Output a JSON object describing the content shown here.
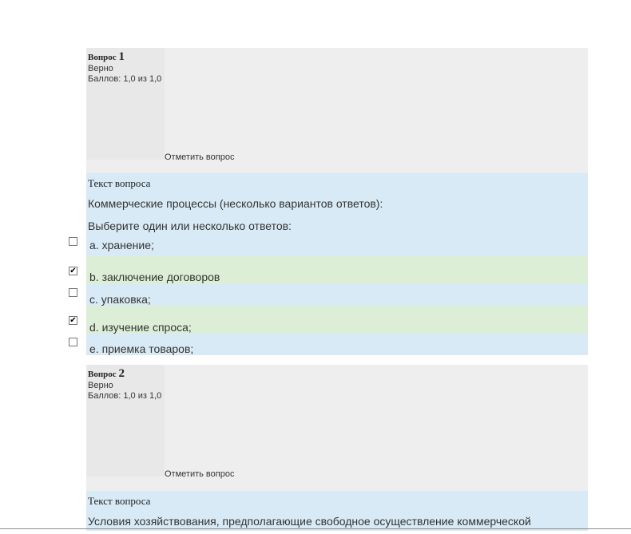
{
  "questions": [
    {
      "label": "Вопрос",
      "number": "1",
      "state": "Верно",
      "grade": "Баллов: 1,0 из 1,0",
      "flag": "Отметить вопрос",
      "qtext_heading": "Текст вопроса",
      "qtext": "Коммерческие процессы (несколько вариантов ответов):",
      "prompt": "Выберите один или несколько ответов:",
      "options": [
        {
          "text": "a. хранение;",
          "checked": "",
          "correct": false
        },
        {
          "text": "b. заключение договоров",
          "checked": "✔",
          "correct": true
        },
        {
          "text": "c. упаковка;",
          "checked": "",
          "correct": false
        },
        {
          "text": "d. изучение спроса;",
          "checked": "✔",
          "correct": true
        },
        {
          "text": "e. приемка товаров;",
          "checked": "",
          "correct": false
        }
      ]
    },
    {
      "label": "Вопрос",
      "number": "2",
      "state": "Верно",
      "grade": "Баллов: 1,0 из 1,0",
      "flag": "Отметить вопрос",
      "qtext_heading": "Текст вопроса",
      "qtext": "Условия хозяйствования, предполагающие свободное осуществление коммерческой"
    }
  ]
}
